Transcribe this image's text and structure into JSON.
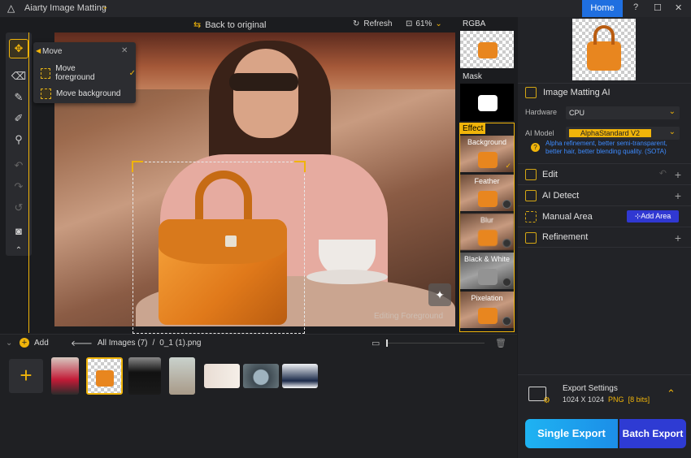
{
  "app": {
    "title": "Aiarty Image Matting",
    "home_label": "Home"
  },
  "window_controls": {
    "help": "?",
    "minimize": "—",
    "maximize": "☐",
    "close": "✕"
  },
  "canvas_toolbar": {
    "back_label": "Back to original",
    "refresh_label": "Refresh",
    "zoom": "61%"
  },
  "move_menu": {
    "title": "Move",
    "items": [
      "Move foreground",
      "Move background"
    ],
    "selected": "Move foreground"
  },
  "canvas": {
    "editing_label": "Editing Foreground"
  },
  "preview": {
    "rgba_label": "RGBA",
    "mask_label": "Mask",
    "effect_label": "Effect",
    "effects": [
      "Background",
      "Feather",
      "Blur",
      "Black & White",
      "Pixelation"
    ],
    "active_effect": "Background"
  },
  "panel": {
    "matting_title": "Image Matting AI",
    "hardware_label": "Hardware",
    "hardware_value": "CPU",
    "model_label": "AI Model",
    "model_value": "AlphaStandard  V2",
    "model_desc": "Alpha refinement, better semi-transparent, better hair, better blending quality. (SOTA)",
    "edit_label": "Edit",
    "ai_detect_label": "AI Detect",
    "manual_area_label": "Manual Area",
    "add_area_label": "Add Area",
    "refinement_label": "Refinement",
    "export_title": "Export Settings",
    "export_size": "1024 X 1024",
    "export_format": "PNG",
    "export_bits": "[8 bits]",
    "single_export": "Single Export",
    "batch_export": "Batch Export"
  },
  "bottom": {
    "add_label": "Add",
    "all_images": "All Images (7)",
    "separator": "/",
    "current_file": "0_1 (1).png"
  },
  "colors": {
    "accent": "#f0b40a",
    "home": "#1f6fe0",
    "single_export": "#1eb3f2",
    "batch_export": "#2e3bd3"
  }
}
